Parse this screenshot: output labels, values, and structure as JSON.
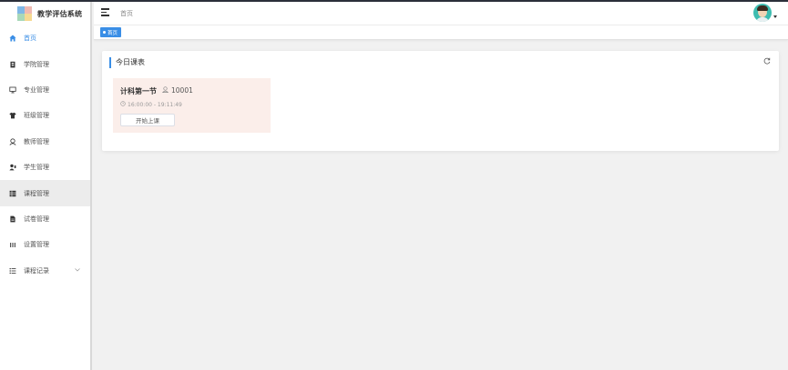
{
  "app": {
    "title": "教学评估系统"
  },
  "header": {
    "breadcrumb": "首页"
  },
  "tags": [
    {
      "label": "首页",
      "active": true
    }
  ],
  "sidebar": {
    "items": [
      {
        "label": "首页",
        "icon": "home-icon"
      },
      {
        "label": "学院管理",
        "icon": "building-icon"
      },
      {
        "label": "专业管理",
        "icon": "monitor-icon"
      },
      {
        "label": "班级管理",
        "icon": "shirt-icon"
      },
      {
        "label": "教师管理",
        "icon": "teacher-icon"
      },
      {
        "label": "学生管理",
        "icon": "student-icon"
      },
      {
        "label": "课程管理",
        "icon": "grid-icon"
      },
      {
        "label": "试卷管理",
        "icon": "document-icon"
      },
      {
        "label": "设置管理",
        "icon": "bars-icon"
      },
      {
        "label": "课程记录",
        "icon": "list-icon"
      }
    ]
  },
  "today": {
    "title": "今日课表",
    "lesson": {
      "name": "计科第一节",
      "room": "10001",
      "time": "16:00:00 - 19:11:49",
      "button": "开始上课"
    }
  },
  "colors": {
    "accent": "#3a8ee6",
    "lesson_bg": "#fbeeea",
    "topline": "#2b2f3a"
  }
}
